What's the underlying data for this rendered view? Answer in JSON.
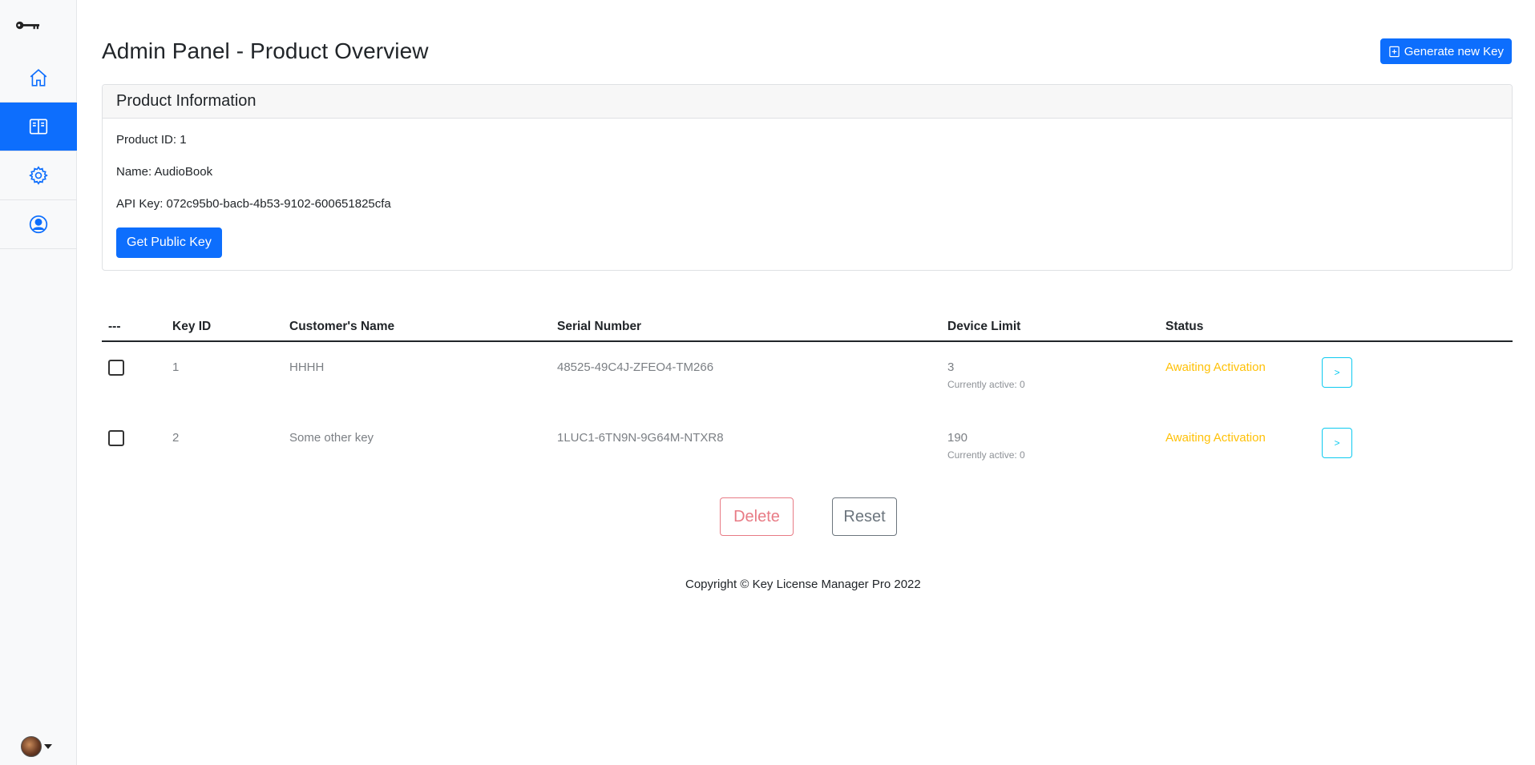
{
  "sidebar": {
    "logo_icon": "key-icon",
    "items": [
      {
        "name": "home",
        "icon": "house-icon",
        "active": false
      },
      {
        "name": "products",
        "icon": "book-icon",
        "active": true
      },
      {
        "name": "settings",
        "icon": "gear-icon",
        "active": false
      },
      {
        "name": "profile",
        "icon": "user-circle-icon",
        "active": false
      }
    ]
  },
  "header": {
    "title": "Admin Panel - Product Overview",
    "generate_label": "Generate new Key"
  },
  "product": {
    "card_title": "Product Information",
    "id_line": "Product ID: 1",
    "name_line": "Name: AudioBook",
    "api_line": "API Key: 072c95b0-bacb-4b53-9102-600651825cfa",
    "public_key_label": "Get Public Key"
  },
  "table": {
    "headers": [
      "---",
      "Key ID",
      "Customer's Name",
      "Serial Number",
      "Device Limit",
      "Status"
    ],
    "rows": [
      {
        "key_id": "1",
        "customer": "HHHH",
        "serial": "48525-49C4J-ZFEO4-TM266",
        "limit": "3",
        "active": "Currently active: 0",
        "status": "Awaiting Activation",
        "open": ">"
      },
      {
        "key_id": "2",
        "customer": "Some other key",
        "serial": "1LUC1-6TN9N-9G64M-NTXR8",
        "limit": "190",
        "active": "Currently active: 0",
        "status": "Awaiting Activation",
        "open": ">"
      }
    ]
  },
  "actions": {
    "delete_label": "Delete",
    "reset_label": "Reset"
  },
  "footer": {
    "copyright": "Copyright © Key License Manager Pro 2022"
  },
  "colors": {
    "primary": "#0d6efd",
    "status_warning": "#ffc107",
    "info": "#0dcaf0",
    "danger": "#dc3545"
  }
}
